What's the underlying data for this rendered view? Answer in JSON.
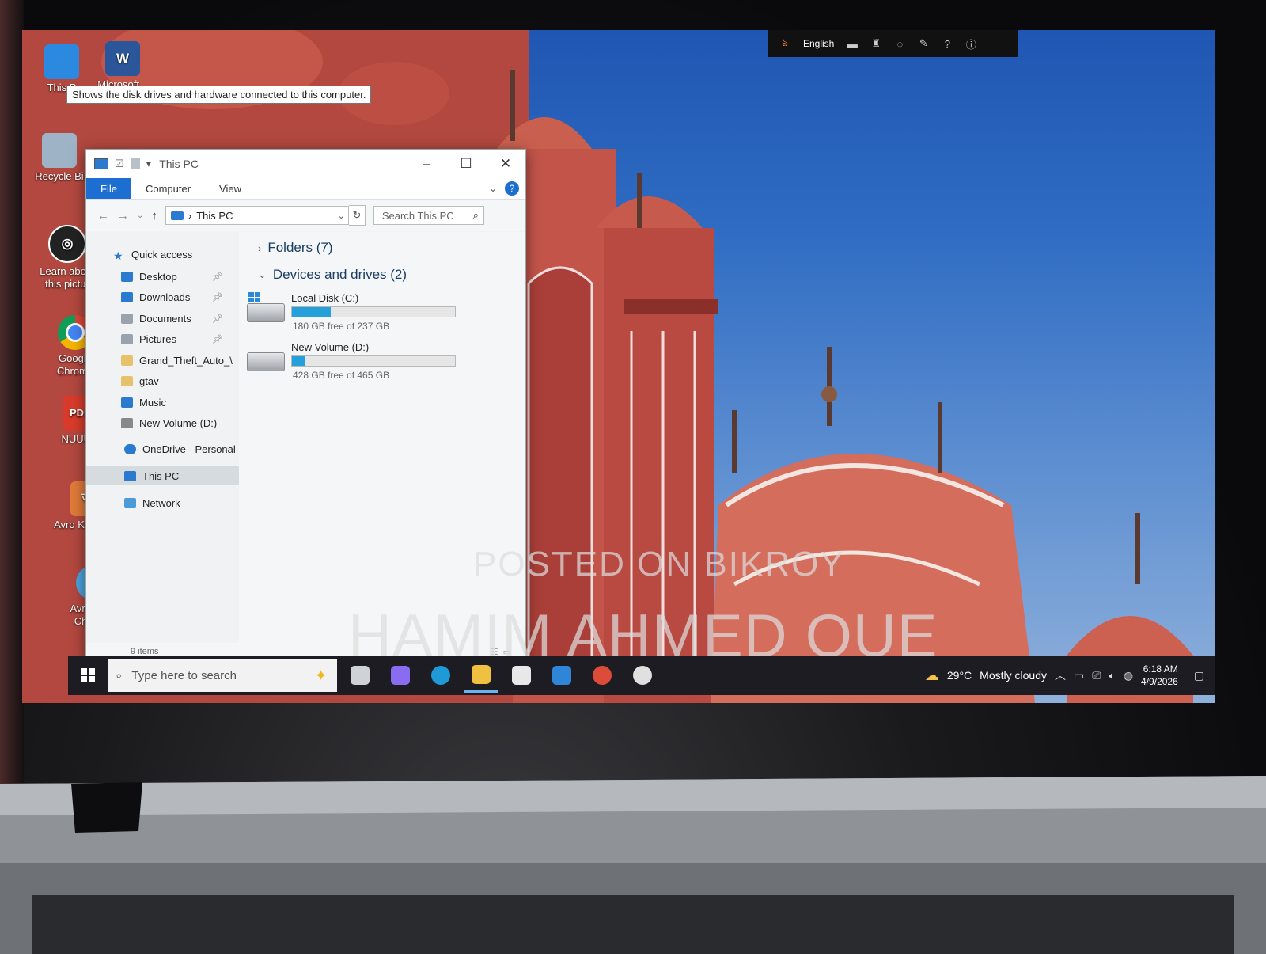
{
  "tooltip": "Shows the disk drives and hardware connected to this computer.",
  "desktop_icons": [
    {
      "label": "This P",
      "icon": "this-pc-icon"
    },
    {
      "label": "Microsoft...",
      "icon": "word-icon"
    },
    {
      "label": "Recycle Bi",
      "icon": "recycle-bin-icon"
    },
    {
      "label": "Learn about this pictur",
      "icon": "learn-about-icon"
    },
    {
      "label": "Google Chrome",
      "icon": "chrome-icon"
    },
    {
      "label": "NUUUU",
      "icon": "pdf-icon"
    },
    {
      "label": "Avro Keyboard",
      "icon": "avro-keyboard-icon"
    },
    {
      "label": "Avro Spell Checker",
      "icon": "avro-spell-checker-icon"
    }
  ],
  "language_bar": {
    "language": "English"
  },
  "explorer": {
    "title": "This PC",
    "ribbon": {
      "file": "File",
      "computer": "Computer",
      "view": "View",
      "help": "?"
    },
    "address": "This PC",
    "search_placeholder": "Search This PC",
    "nav": {
      "quick_access": "Quick access",
      "items": [
        {
          "label": "Desktop",
          "pinned": true,
          "color": "#2a7bd0"
        },
        {
          "label": "Downloads",
          "pinned": true,
          "color": "#2a7bd0"
        },
        {
          "label": "Documents",
          "pinned": true,
          "color": "#9aa3ad"
        },
        {
          "label": "Pictures",
          "pinned": true,
          "color": "#9aa3ad"
        },
        {
          "label": "Grand_Theft_Auto_\\",
          "pinned": false,
          "color": "#e8c26a"
        },
        {
          "label": "gtav",
          "pinned": false,
          "color": "#e8c26a"
        },
        {
          "label": "Music",
          "pinned": false,
          "color": "#2a7bd0"
        },
        {
          "label": "New Volume (D:)",
          "pinned": false,
          "color": "#888888"
        }
      ],
      "onedrive": "OneDrive - Personal",
      "this_pc": "This PC",
      "network": "Network"
    },
    "folders_header": "Folders (7)",
    "devices_header": "Devices and drives (2)",
    "drives": [
      {
        "name": "Local Disk (C:)",
        "free_text": "180 GB free of 237 GB",
        "used_fraction": 0.24
      },
      {
        "name": "New Volume (D:)",
        "free_text": "428 GB free of 465 GB",
        "used_fraction": 0.08
      }
    ],
    "status": "9 items"
  },
  "taskbar": {
    "search_placeholder": "Type here to search",
    "apps": [
      {
        "name": "task-view",
        "color": "#cfd3d8"
      },
      {
        "name": "copilot",
        "color": "#8a6cf0"
      },
      {
        "name": "edge",
        "color": "#1e9ad6"
      },
      {
        "name": "file-explorer",
        "color": "#f0c040"
      },
      {
        "name": "microsoft-store",
        "color": "#e8e8e8"
      },
      {
        "name": "mail",
        "color": "#2f86d6"
      },
      {
        "name": "chrome",
        "color": "#dd4b39"
      },
      {
        "name": "unknown-app",
        "color": "#e0e0e0"
      }
    ],
    "weather_temp": "29°C",
    "weather_desc": "Mostly cloudy",
    "time": "6:18 AM",
    "date": "4/9/2026"
  },
  "watermark": {
    "line1": "POSTED ON BIKROY",
    "line2": "HAMIM AHMED QUE"
  }
}
